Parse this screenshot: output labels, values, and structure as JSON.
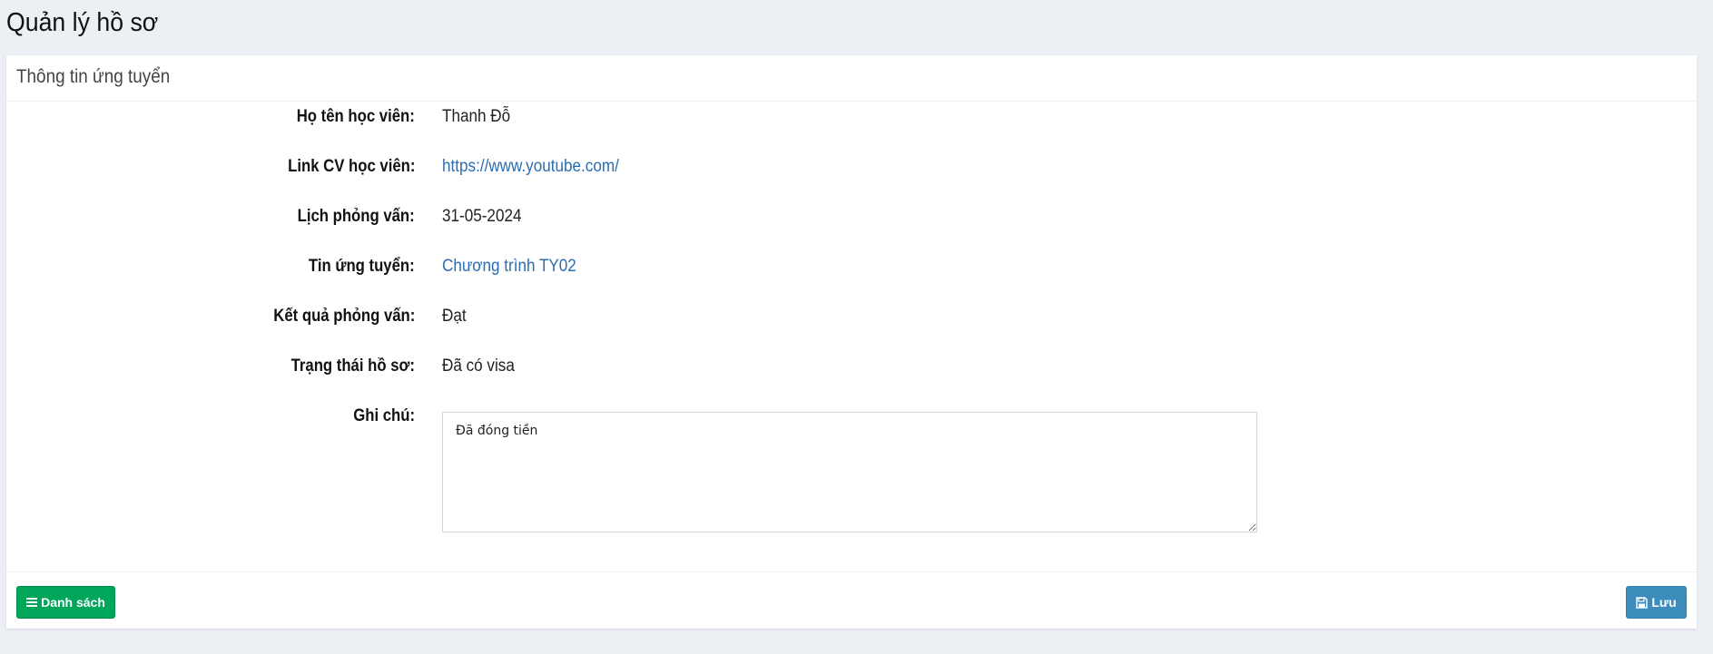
{
  "page": {
    "title": "Quản lý hồ sơ"
  },
  "panel": {
    "title": "Thông tin ứng tuyển"
  },
  "fields": [
    {
      "label": "Họ tên học viên:",
      "value": "Thanh Đỗ"
    },
    {
      "label": "Link CV học viên:",
      "value": "https://www.youtube.com/"
    },
    {
      "label": "Lịch phỏng vấn:",
      "value": "31-05-2024"
    },
    {
      "label": "Tin ứng tuyển:",
      "value": "Chương trình TY02"
    },
    {
      "label": "Kết quả phỏng vấn:",
      "value": "Đạt"
    },
    {
      "label": "Trạng thái hồ sơ:",
      "value": "Đã có visa"
    }
  ],
  "note": {
    "label": "Ghi chú:",
    "value": "Đã đóng tiền"
  },
  "footer": {
    "list_button_label": "Danh sách",
    "list_button_icon": "list-icon",
    "save_button_label": "Lưu",
    "save_button_icon": "floppy-disk-icon"
  },
  "colors": {
    "background": "#ecf0f5",
    "link": "#2a6db0",
    "success": "#00a65a",
    "primary": "#3c8dbc"
  }
}
